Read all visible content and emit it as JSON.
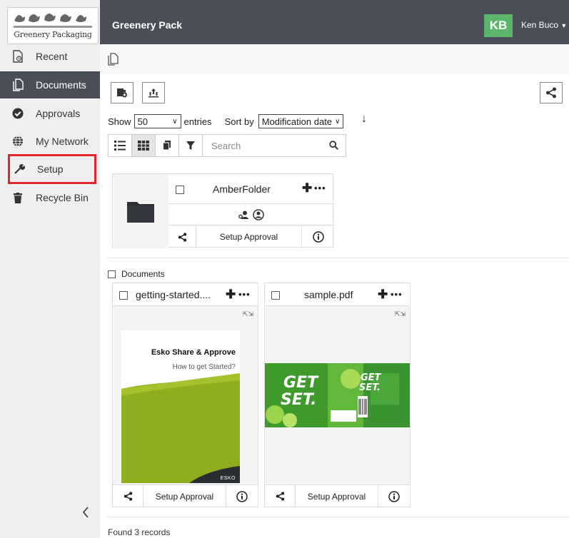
{
  "brand": {
    "logo_text": "Greenery Packaging"
  },
  "header": {
    "app_title": "Greenery Pack",
    "user_initials": "KB",
    "user_name": "Ken Buco"
  },
  "sidebar": {
    "items": [
      {
        "label": "Recent",
        "icon": "recent-icon"
      },
      {
        "label": "Documents",
        "icon": "documents-icon",
        "active": true
      },
      {
        "label": "Approvals",
        "icon": "approvals-check-icon"
      },
      {
        "label": "My Network",
        "icon": "globe-icon"
      },
      {
        "label": "Setup",
        "icon": "wrench-icon",
        "highlighted": true
      },
      {
        "label": "Recycle Bin",
        "icon": "trash-icon"
      }
    ]
  },
  "toolbar": {
    "show_label": "Show",
    "entries_value": "50",
    "entries_label": "entries",
    "sort_label": "Sort by",
    "sort_value": "Modification date",
    "search_placeholder": "Search"
  },
  "folder": {
    "name": "AmberFolder",
    "share_label": "Setup Approval"
  },
  "documents_section": {
    "label": "Documents"
  },
  "documents": [
    {
      "name": "getting-started....",
      "action_label": "Setup Approval",
      "thumb_title": "Esko Share & Approve",
      "thumb_subtitle": "How to get Started?",
      "thumb_brand": "ESKO"
    },
    {
      "name": "sample.pdf",
      "action_label": "Setup Approval",
      "thumb_text_a": "GET",
      "thumb_text_b": "SET."
    }
  ],
  "footer": {
    "records_text": "Found 3 records"
  },
  "colors": {
    "header_bg": "#4a4e59",
    "avatar_bg": "#5bb56b",
    "highlight": "#e2262b",
    "sidebar_bg": "#efefef"
  }
}
